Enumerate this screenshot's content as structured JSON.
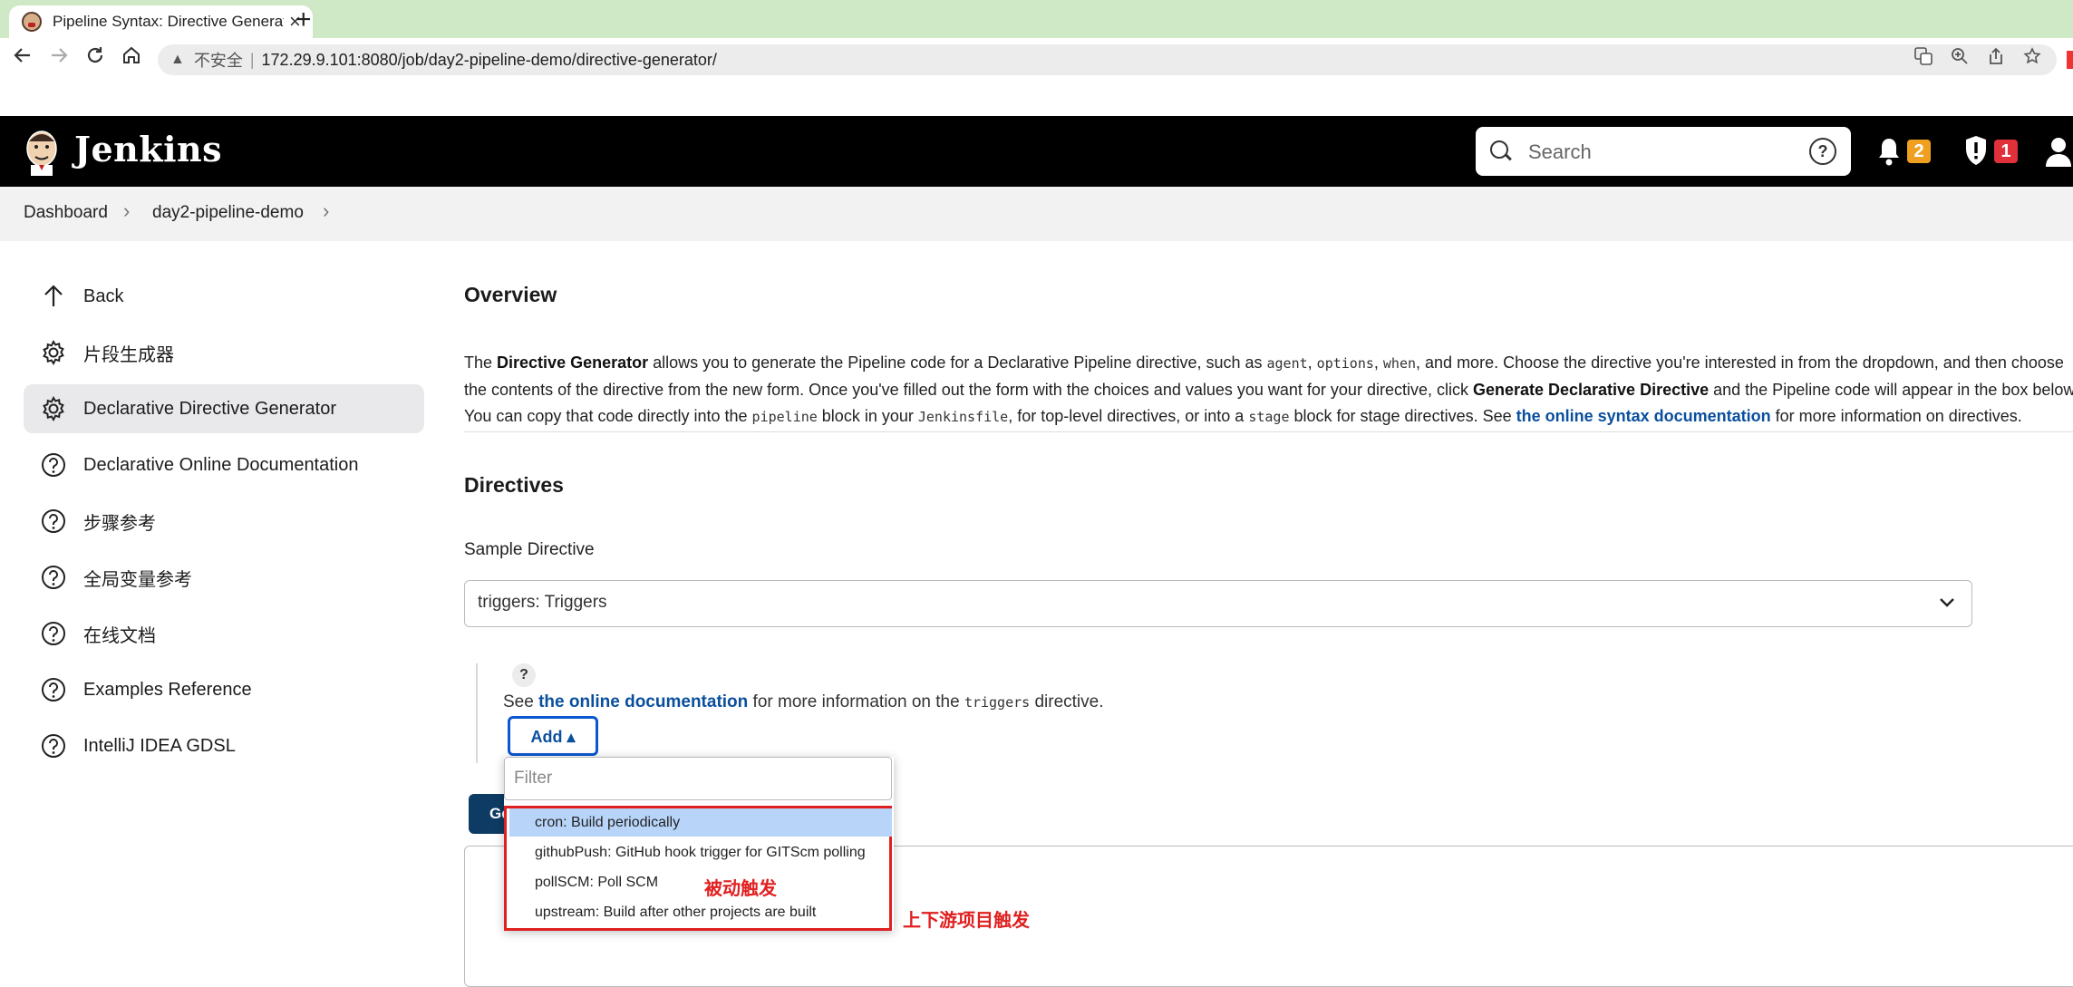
{
  "browser": {
    "tab_title": "Pipeline Syntax: Directive Generator",
    "url_warning": "不安全",
    "url_host": "172.29.9.101",
    "url_rest": ":8080/job/day2-pipeline-demo/directive-generator/"
  },
  "header": {
    "brand": "Jenkins",
    "search_placeholder": "Search",
    "notifications_count": "2",
    "security_count": "1",
    "colors": {
      "bar": "#000000",
      "notif_badge": "#f0a020",
      "security_badge": "#e0303a"
    }
  },
  "breadcrumb": [
    "Dashboard",
    "day2-pipeline-demo"
  ],
  "sidebar": {
    "items": [
      {
        "label": "Back",
        "icon": "arrow-up-icon"
      },
      {
        "label": "片段生成器",
        "icon": "gear-icon"
      },
      {
        "label": "Declarative Directive Generator",
        "icon": "gear-icon",
        "active": true
      },
      {
        "label": "Declarative Online Documentation",
        "icon": "help-circle-icon"
      },
      {
        "label": "步骤参考",
        "icon": "help-circle-icon"
      },
      {
        "label": "全局变量参考",
        "icon": "help-circle-icon"
      },
      {
        "label": "在线文档",
        "icon": "help-circle-icon"
      },
      {
        "label": "Examples Reference",
        "icon": "help-circle-icon"
      },
      {
        "label": "IntelliJ IDEA GDSL",
        "icon": "help-circle-icon"
      }
    ]
  },
  "main": {
    "overview_title": "Overview",
    "desc": {
      "p1": "The ",
      "b1": "Directive Generator",
      "p2": " allows you to generate the Pipeline code for a Declarative Pipeline directive, such as ",
      "c1": "agent",
      "p3": ", ",
      "c2": "options",
      "p4": ", ",
      "c3": "when",
      "p5": ", and more. Choose the directive you're interested in from the dropdown, and then choose the contents of the directive from the new form. Once you've filled out the form with the choices and values you want for your directive, click ",
      "b2": "Generate Declarative Directive",
      "p6": " and the Pipeline code will appear in the box below. You can copy that code directly into the ",
      "c4": "pipeline",
      "p7": " block in your ",
      "c5": "Jenkinsfile",
      "p8": ", for top-level directives, or into a ",
      "c6": "stage",
      "p9": " block for stage directives. See ",
      "link": "the online syntax documentation",
      "p10": " for more information on directives."
    },
    "directives_title": "Directives",
    "sample_label": "Sample Directive",
    "sample_value": "triggers: Triggers",
    "help_mark": "?",
    "doc": {
      "pre": "See ",
      "link": "the online documentation",
      "mid": " for more information on the ",
      "code": "triggers",
      "post": " directive."
    },
    "add_label": "Add ▴",
    "generate_label": "Generate Declarative Directive"
  },
  "dropdown": {
    "filter_placeholder": "Filter",
    "options": [
      "cron: Build periodically",
      "githubPush: GitHub hook trigger for GITScm polling",
      "pollSCM: Poll SCM",
      "upstream: Build after other projects are built"
    ],
    "selected_index": 0
  },
  "annotations": {
    "passive": "被动触发",
    "upstream": "上下游项目触发",
    "color": "#e02020"
  }
}
